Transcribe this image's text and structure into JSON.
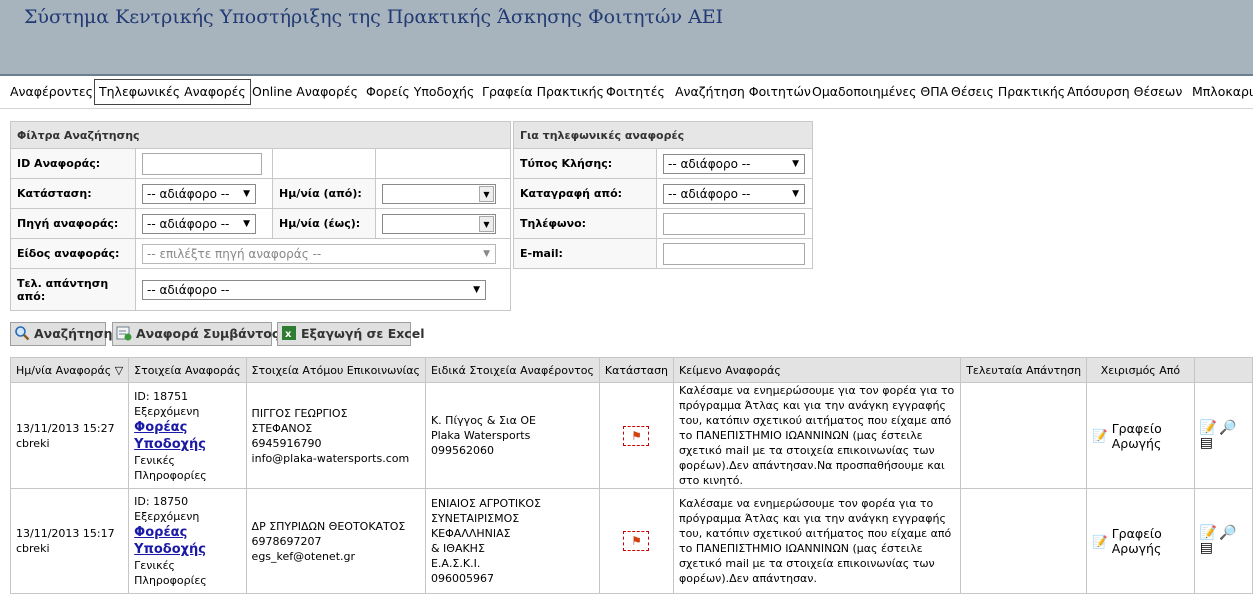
{
  "app": {
    "title": "Σύστημα Κεντρικής Υποστήριξης της Πρακτικής Άσκησης Φοιτητών ΑΕΙ"
  },
  "nav": {
    "items": [
      "Αναφέροντες",
      "Τηλεφωνικές Αναφορές",
      "Online Αναφορές",
      "Φορείς Υποδοχής",
      "Γραφεία Πρακτικής",
      "Φοιτητές",
      "Αναζήτηση Φοιτητών",
      "Ομαδοποιημένες ΘΠΑ",
      "Θέσεις Πρακτικής",
      "Απόσυρση Θέσεων",
      "Μπλοκαρισ"
    ],
    "active": "Τηλεφωνικές Αναφορές"
  },
  "filters": {
    "heading": "Φίλτρα Αναζήτησης",
    "id_label": "ID Αναφοράς:",
    "status_label": "Κατάσταση:",
    "status_value": "-- αδιάφορο --",
    "date_from_label": "Ημ/νία (από):",
    "date_to_label": "Ημ/νία (έως):",
    "source_label": "Πηγή αναφοράς:",
    "source_value": "-- αδιάφορο --",
    "type_label": "Είδος αναφοράς:",
    "type_placeholder": "-- επιλέξτε πηγή αναφοράς --",
    "last_answer_label": "Τελ. απάντηση από:",
    "last_answer_value": "-- αδιάφορο --"
  },
  "phone_filters": {
    "heading": "Για τηλεφωνικές αναφορές",
    "call_type_label": "Τύπος Κλήσης:",
    "call_type_value": "-- αδιάφορο --",
    "recorded_by_label": "Καταγραφή από:",
    "recorded_by_value": "-- αδιάφορο --",
    "phone_label": "Τηλέφωνο:",
    "email_label": "E-mail:"
  },
  "toolbar": {
    "search": "Αναζήτηση",
    "incident": "Αναφορά Συμβάντος",
    "export": "Εξαγωγή σε Excel"
  },
  "grid": {
    "columns": [
      "Ημ/νία Αναφοράς",
      "Στοιχεία Αναφοράς",
      "Στοιχεία Ατόμου Επικοινωνίας",
      "Ειδικά Στοιχεία Αναφέροντος",
      "Κατάσταση",
      "Κείμενο Αναφοράς",
      "Τελευταία Απάντηση",
      "Χειρισμός Από",
      ""
    ],
    "sort_icon": "▽",
    "rows": [
      {
        "date": "13/11/2013 15:27",
        "user": "cbreki",
        "id": "ID: 18751",
        "state": "Εξερχόμενη",
        "type": "Φορέας Υποδοχής",
        "sub1": "Γενικές",
        "sub2": "Πληροφορίες",
        "contact1": "ΠΙΓΓΟΣ ΓΕΩΡΓΙΟΣ",
        "contact2": "ΣΤΕΦΑΝΟΣ",
        "contact3": "6945916790",
        "contact4": "info@plaka-watersports.com",
        "special1": "Κ. Πίγγος & Σια ΟΕ",
        "special2": "Plaka Watersports",
        "special3": "099562060",
        "special4": "",
        "text": "Καλέσαμε να ενημερώσουμε για τον φορέα για το πρόγραμμα Άτλας και για την ανάγκη εγγραφής του, κατόπιν σχετικού αιτήματος που είχαμε από το ΠΑΝΕΠΙΣΤΗΜΙΟ ΙΩΑΝΝΙΝΩΝ (μας έστειλε σχετικό mail με τα στοιχεία επικοινωνίας των φορέων).Δεν απάντησαν.Να προσπαθήσουμε και στο κινητό.",
        "handler": "Γραφείο Αρωγής"
      },
      {
        "date": "13/11/2013 15:17",
        "user": "cbreki",
        "id": "ID: 18750",
        "state": "Εξερχόμενη",
        "type": "Φορέας Υποδοχής",
        "sub1": "Γενικές",
        "sub2": "Πληροφορίες",
        "contact1": "ΔΡ ΣΠΥΡΙΔΩΝ ΘΕΟΤΟΚΑΤΟΣ",
        "contact2": "6978697207",
        "contact3": "egs_kef@otenet.gr",
        "contact4": "",
        "special1": "ΕΝΙΑΙΟΣ ΑΓΡΟΤΙΚΟΣ",
        "special2": "ΣΥΝΕΤΑΙΡΙΣΜΟΣ ΚΕΦΑΛΛΗΝΙΑΣ",
        "special3": "& ΙΘΑΚΗΣ",
        "special4": "Ε.Α.Σ.Κ.Ι.",
        "special5": "096005967",
        "text": "Καλέσαμε να ενημερώσουμε τον φορέα για το πρόγραμμα Άτλας και για την ανάγκη εγγραφής του, κατόπιν σχετικού αιτήματος που είχαμε από το ΠΑΝΕΠΙΣΤΗΜΙΟ ΙΩΑΝΝΙΝΩΝ (μας έστειλε σχετικό mail με τα στοιχεία επικοινωνίας των φορέων).Δεν απάντησαν.",
        "handler": "Γραφείο Αρωγής"
      }
    ]
  }
}
